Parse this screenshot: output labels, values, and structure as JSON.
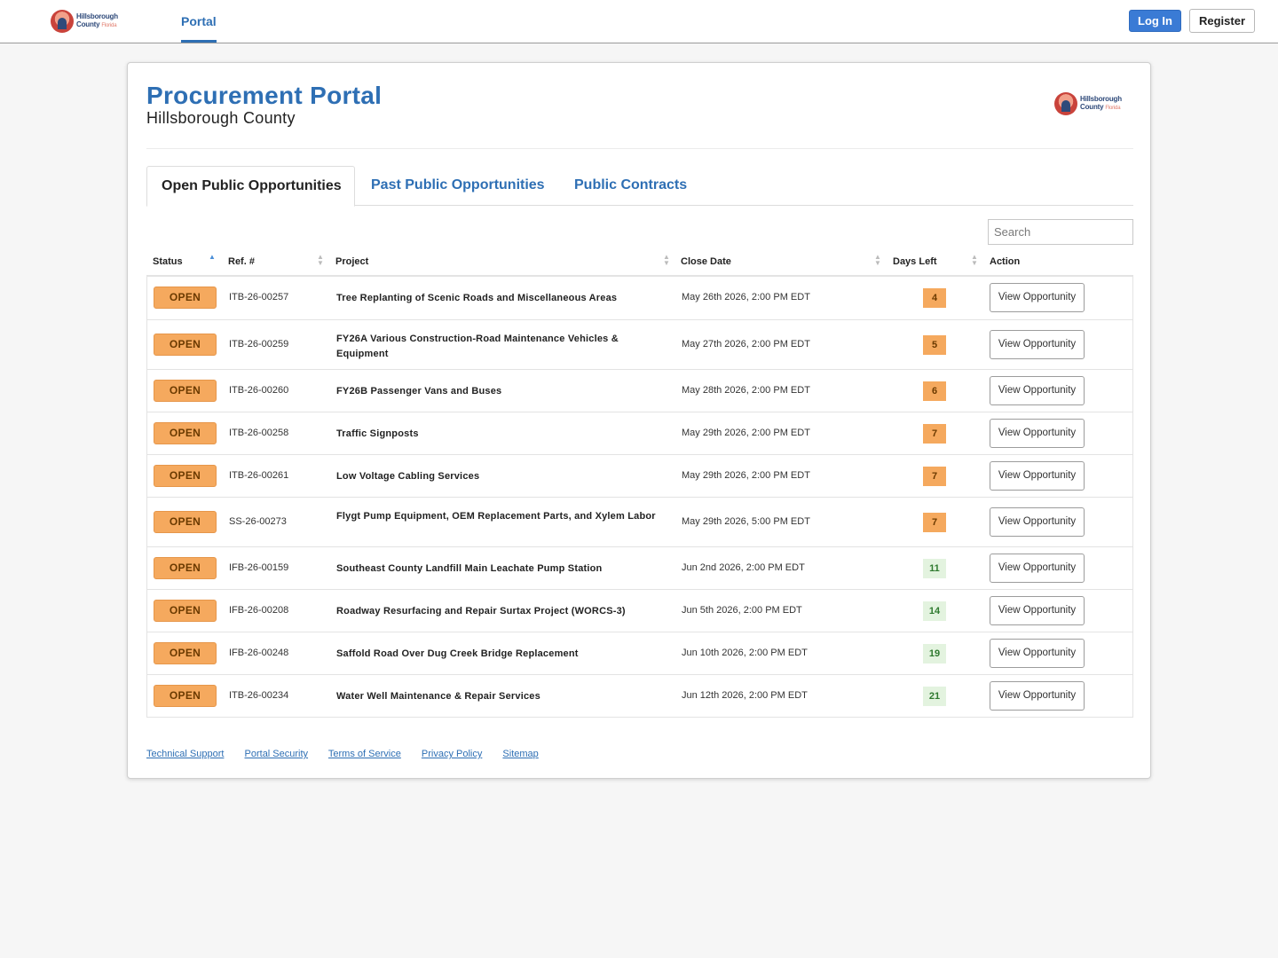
{
  "brand": {
    "logo_name": "Hillsborough",
    "logo_sub": "County",
    "logo_fl": "Florida"
  },
  "nav": {
    "portal": "Portal",
    "login": "Log In",
    "register": "Register"
  },
  "header": {
    "title": "Procurement Portal",
    "subtitle": "Hillsborough County"
  },
  "tabs": [
    {
      "label": "Open Public Opportunities",
      "active": true
    },
    {
      "label": "Past Public Opportunities",
      "active": false
    },
    {
      "label": "Public Contracts",
      "active": false
    }
  ],
  "search": {
    "placeholder": "Search"
  },
  "table": {
    "columns": [
      "Status",
      "Ref. #",
      "Project",
      "Close Date",
      "Days Left",
      "Action"
    ],
    "rows": [
      {
        "status": "OPEN",
        "ref": "ITB-26-00257",
        "project": "Tree Replanting of Scenic Roads and Miscellaneous Areas",
        "close": "May 26th 2026, 2:00 PM EDT",
        "days": "4",
        "action": "View Opportunity"
      },
      {
        "status": "OPEN",
        "ref": "ITB-26-00259",
        "project": "FY26A Various Construction-Road Maintenance Vehicles & Equipment",
        "close": "May 27th 2026, 2:00 PM EDT",
        "days": "5",
        "action": "View Opportunity"
      },
      {
        "status": "OPEN",
        "ref": "ITB-26-00260",
        "project": "FY26B Passenger Vans and Buses",
        "close": "May 28th 2026, 2:00 PM EDT",
        "days": "6",
        "action": "View Opportunity"
      },
      {
        "status": "OPEN",
        "ref": "ITB-26-00258",
        "project": "Traffic Signposts",
        "close": "May 29th 2026, 2:00 PM EDT",
        "days": "7",
        "action": "View Opportunity"
      },
      {
        "status": "OPEN",
        "ref": "ITB-26-00261",
        "project": "Low Voltage Cabling Services",
        "close": "May 29th 2026, 2:00 PM EDT",
        "days": "7",
        "action": "View Opportunity"
      },
      {
        "status": "OPEN",
        "ref": "SS-26-00273",
        "project": "Flygt Pump Equipment, OEM Replacement Parts, and Xylem Labor",
        "close": "May 29th 2026, 5:00 PM EDT",
        "days": "7",
        "action": "View Opportunity"
      },
      {
        "status": "OPEN",
        "ref": "IFB-26-00159",
        "project": "Southeast County Landfill Main Leachate Pump Station",
        "close": "Jun 2nd 2026, 2:00 PM EDT",
        "days": "11",
        "action": "View Opportunity"
      },
      {
        "status": "OPEN",
        "ref": "IFB-26-00208",
        "project": "Roadway Resurfacing and Repair Surtax Project (WORCS-3)",
        "close": "Jun 5th 2026, 2:00 PM EDT",
        "days": "14",
        "action": "View Opportunity"
      },
      {
        "status": "OPEN",
        "ref": "IFB-26-00248",
        "project": "Saffold Road Over Dug Creek Bridge Replacement",
        "close": "Jun 10th 2026, 2:00 PM EDT",
        "days": "19",
        "action": "View Opportunity"
      },
      {
        "status": "OPEN",
        "ref": "ITB-26-00234",
        "project": "Water Well Maintenance & Repair Services",
        "close": "Jun 12th 2026, 2:00 PM EDT",
        "days": "21",
        "action": "View Opportunity"
      }
    ]
  },
  "footer": {
    "links": [
      "Technical Support",
      "Portal Security",
      "Terms of Service",
      "Privacy Policy",
      "Sitemap"
    ]
  },
  "colors": {
    "accent": "#2e6fb4",
    "open_badge": "#f5a95e",
    "days_warn": "#f5a95e",
    "days_ok": "#e3f3df"
  }
}
